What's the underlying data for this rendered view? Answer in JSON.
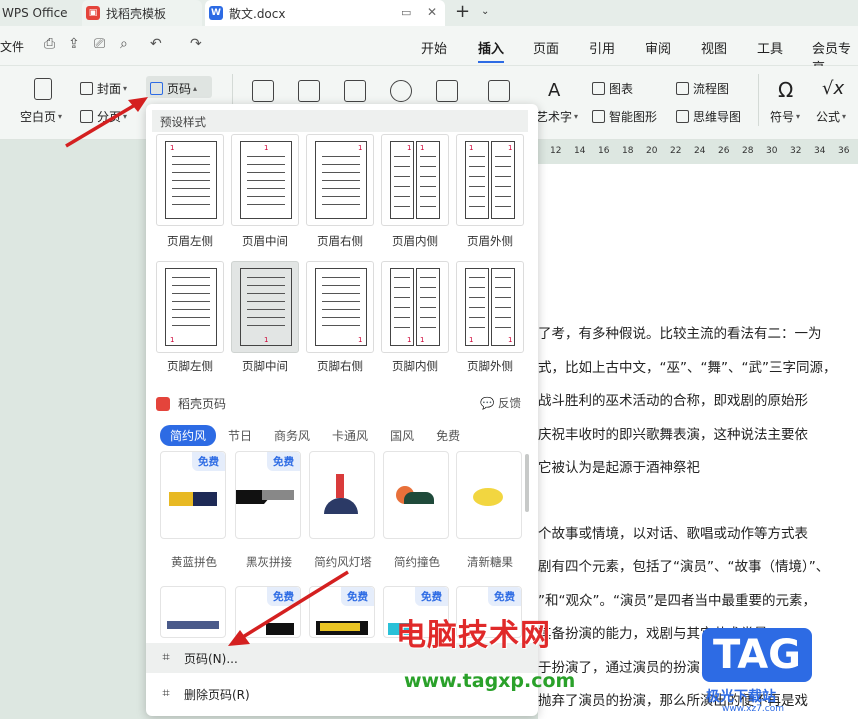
{
  "titlebar": {
    "app_tab": "WPS Office",
    "tab_template": "找稻壳模板",
    "tab_doc": "散文.docx",
    "new_tab": "+"
  },
  "menubar": {
    "file": "文件",
    "tabs": [
      "开始",
      "插入",
      "页面",
      "引用",
      "审阅",
      "视图",
      "工具",
      "会员专享"
    ],
    "active_tab": "插入"
  },
  "ribbon": {
    "blank_page": "空白页",
    "cover": "封面",
    "page_break": "分页",
    "page_number": "页码",
    "art_text": "艺术字",
    "chart": "图表",
    "smart_shape": "智能图形",
    "flowchart": "流程图",
    "mindmap": "思维导图",
    "symbol": "符号",
    "formula": "公式"
  },
  "ruler": [
    "12",
    "14",
    "16",
    "18",
    "20",
    "22",
    "24",
    "26",
    "28",
    "30",
    "32",
    "34",
    "36"
  ],
  "panel": {
    "preset_title": "预设样式",
    "header_presets": [
      "页眉左侧",
      "页眉中间",
      "页眉右侧",
      "页眉内侧",
      "页眉外侧"
    ],
    "footer_presets": [
      "页脚左侧",
      "页脚中间",
      "页脚右侧",
      "页脚内侧",
      "页脚外侧"
    ],
    "daoke_title": "稻壳页码",
    "feedback": "反馈",
    "filters": [
      "简约风",
      "节日",
      "商务风",
      "卡通风",
      "国风",
      "免费"
    ],
    "active_filter": "简约风",
    "badge": "免费",
    "cards": [
      "黄蓝拼色",
      "黑灰拼接",
      "简约风灯塔",
      "简约撞色",
      "清新糖果"
    ],
    "cmd_page_number": "页码(N)...",
    "cmd_delete": "删除页码(R)"
  },
  "document": {
    "lines": [
      "了考，有多种假说。比较主流的看法有二：一为",
      "式，比如上古中文，“巫”、“舞”、“武”三字同源，",
      "战斗胜利的巫术活动的合称，即戏剧的原始形",
      "庆祝丰收时的即兴歌舞表演，这种说法主要依",
      "它被认为是起源于酒神祭祀",
      "个故事或情境，以对话、歌唱或动作等方式表",
      "剧有四个元素，包括了“演员”、“故事（情境）”、",
      "”和“观众”。“演员”是四者当中最重要的元素，",
      "其备扮演的能力，戏剧与其它艺术类最",
      "于扮演了，通过演员的扮演，剧本中的角色才",
      "抛弃了演员的扮演，那么所演出的便不再是戏"
    ]
  },
  "watermark": {
    "site_cn": "电脑技术网",
    "site_url": "www.tagxp.com",
    "tag": "TAG",
    "tag_sub": "极光下载站",
    "tag_url": "www.xz7.com"
  },
  "colors": {
    "accent": "#2d6be4",
    "arrow": "#d42020",
    "page_num": "#cc0033"
  }
}
